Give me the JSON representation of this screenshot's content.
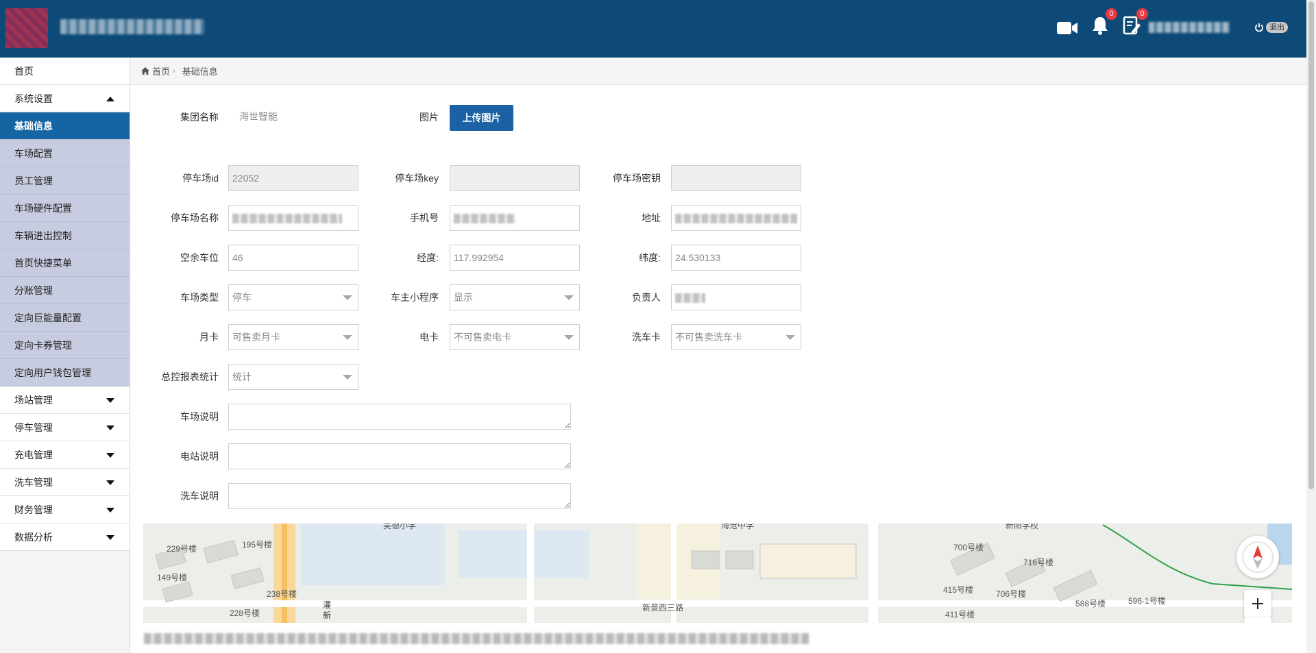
{
  "header": {
    "notifications_count": "0",
    "tasks_count": "0",
    "logout_label": "退出"
  },
  "breadcrumb": {
    "home": "首页",
    "current": "基础信息"
  },
  "sidebar": {
    "items": [
      {
        "label": "首页"
      },
      {
        "label": "系统设置"
      },
      {
        "label": "基础信息"
      },
      {
        "label": "车场配置"
      },
      {
        "label": "员工管理"
      },
      {
        "label": "车场硬件配置"
      },
      {
        "label": "车辆进出控制"
      },
      {
        "label": "首页快捷菜单"
      },
      {
        "label": "分账管理"
      },
      {
        "label": "定向巨能量配置"
      },
      {
        "label": "定向卡券管理"
      },
      {
        "label": "定向用户钱包管理"
      },
      {
        "label": "场站管理"
      },
      {
        "label": "停车管理"
      },
      {
        "label": "充电管理"
      },
      {
        "label": "洗车管理"
      },
      {
        "label": "财务管理"
      },
      {
        "label": "数据分析"
      }
    ]
  },
  "form": {
    "group_name_label": "集团名称",
    "group_name_value": "海世智能",
    "image_label": "图片",
    "upload_button": "上传图片",
    "lot_id_label": "停车场id",
    "lot_id_value": "22052",
    "lot_key_label": "停车场key",
    "lot_secret_label": "停车场密钥",
    "lot_name_label": "停车场名称",
    "phone_label": "手机号",
    "address_label": "地址",
    "free_spaces_label": "空余车位",
    "free_spaces_value": "46",
    "longitude_label": "经度:",
    "longitude_value": "117.992954",
    "latitude_label": "纬度:",
    "latitude_value": "24.530133",
    "lot_type_label": "车场类型",
    "lot_type_value": "停车",
    "miniprogram_label": "车主小程序",
    "miniprogram_value": "显示",
    "manager_label": "负责人",
    "monthly_card_label": "月卡",
    "monthly_card_value": "可售卖月卡",
    "e_card_label": "电卡",
    "e_card_value": "不可售卖电卡",
    "wash_card_label": "洗车卡",
    "wash_card_value": "不可售卖洗车卡",
    "report_label": "总控报表统计",
    "report_value": "统计",
    "lot_desc_label": "车场说明",
    "station_desc_label": "电站说明",
    "wash_desc_label": "洗车说明"
  },
  "map": {
    "labels": [
      "229号楼",
      "195号楼",
      "149号楼",
      "238号楼",
      "228号楼",
      "灌新",
      "新景西三路",
      "700号楼",
      "716号楼",
      "415号楼",
      "706号楼",
      "588号楼",
      "596-1号楼",
      "411号楼",
      "吴德小学",
      "海沧中学",
      "新阳学校"
    ]
  },
  "colors": {
    "header": "#0e4a78",
    "active_nav": "#1565a3",
    "submenu": "#c8cce0",
    "button": "#1a62a4",
    "badge": "#e8393f"
  }
}
